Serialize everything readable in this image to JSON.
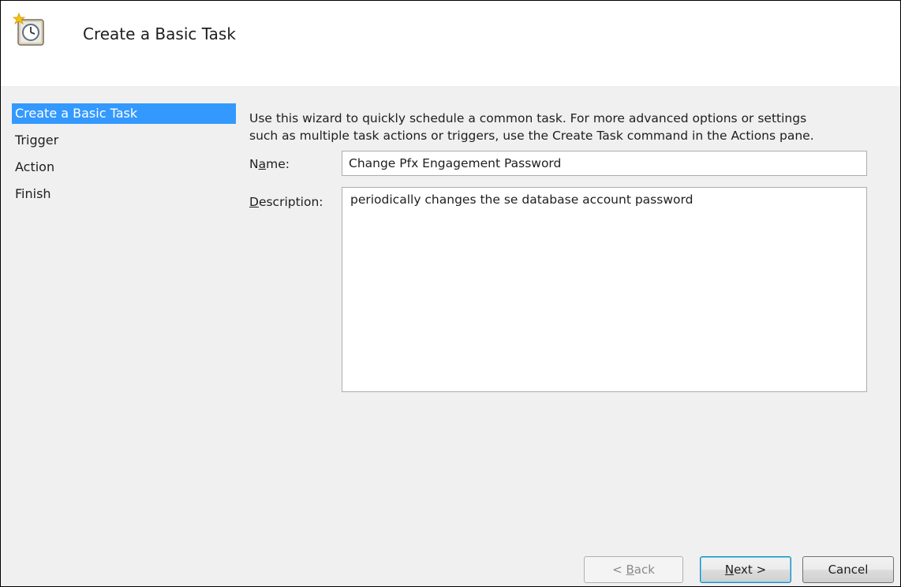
{
  "header": {
    "title": "Create a Basic Task",
    "icon": "scheduled-task-clock-icon"
  },
  "sidebar": {
    "steps": [
      {
        "label": "Create a Basic Task",
        "active": true
      },
      {
        "label": "Trigger",
        "active": false
      },
      {
        "label": "Action",
        "active": false
      },
      {
        "label": "Finish",
        "active": false
      }
    ]
  },
  "main": {
    "intro_line1": "Use this wizard to quickly schedule a common task.  For more advanced options or settings",
    "intro_line2": "such as multiple task actions or triggers, use the Create Task command in the Actions pane.",
    "name_label_pre": "N",
    "name_label_accel": "a",
    "name_label_post": "me:",
    "name_value": "Change Pfx Engagement Password",
    "description_label_accel": "D",
    "description_label_post": "escription:",
    "description_value": "periodically changes the se database account password"
  },
  "footer": {
    "back_label_pre": "< ",
    "back_label_accel": "B",
    "back_label_post": "ack",
    "next_label_accel": "N",
    "next_label_post": "ext >",
    "cancel_label": "Cancel"
  },
  "colors": {
    "selection": "#3399ff",
    "panel": "#f0f0f0",
    "header": "#ffffff"
  }
}
